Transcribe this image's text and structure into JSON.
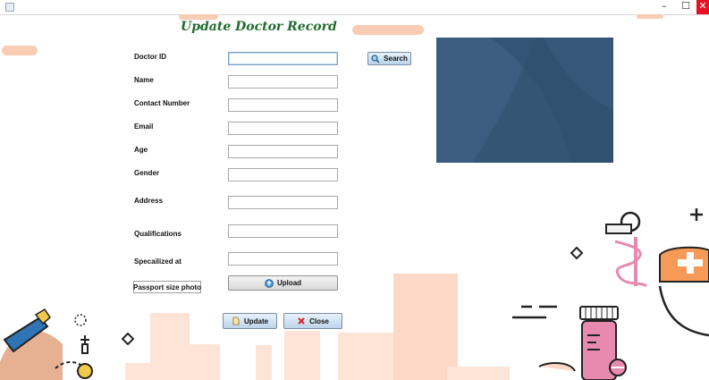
{
  "window": {
    "minimize_glyph": "–",
    "maximize_glyph": "☐",
    "close_glyph": "✕"
  },
  "page_title": "Update Doctor  Record",
  "form": {
    "doctor_id_label": "Doctor ID",
    "name_label": "Name",
    "contact_label": "Contact Number",
    "email_label": "Email",
    "age_label": "Age",
    "gender_label": "Gender",
    "address_label": "Address",
    "qualifications_label": "Qualifications",
    "specialized_label": "Specailized at",
    "photo_label": "Passport size photo"
  },
  "buttons": {
    "search": "Search",
    "upload": "Upload",
    "update": "Update",
    "close": "Close"
  },
  "icons": {
    "search": "magnifier-icon",
    "upload": "upload-circle-icon",
    "update": "document-icon",
    "close": "red-x-icon"
  },
  "colors": {
    "title": "#1f6b2e",
    "photo_panel": "#345675",
    "decor_peach": "#f8cdb3",
    "decor_pink": "#e88ab0",
    "decor_orange": "#f59a57"
  }
}
